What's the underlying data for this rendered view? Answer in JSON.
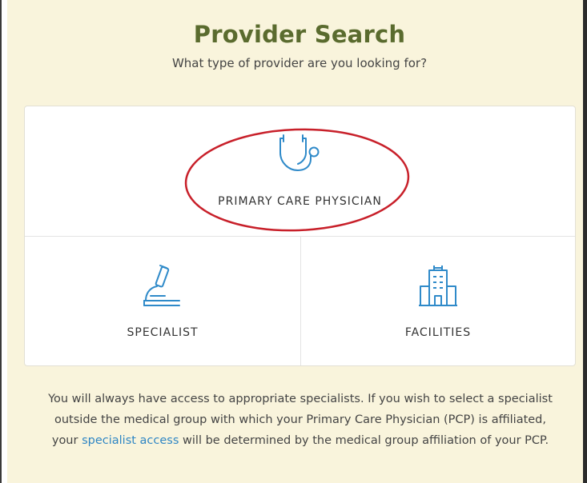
{
  "header": {
    "title": "Provider Search",
    "subtitle": "What type of provider are you looking for?"
  },
  "options": {
    "primary": {
      "label": "PRIMARY CARE PHYSICIAN",
      "icon": "stethoscope-icon"
    },
    "specialist": {
      "label": "SPECIALIST",
      "icon": "microscope-icon"
    },
    "facilities": {
      "label": "FACILITIES",
      "icon": "hospital-building-icon"
    }
  },
  "info": {
    "before_link": "You will always have access to appropriate specialists. If you wish to select a specialist outside the medical group with which your Primary Care Physician (PCP) is affiliated, your ",
    "link_text": "specialist access",
    "after_link": " will be determined by the medical group affiliation of your PCP."
  },
  "colors": {
    "title": "#5a6b2e",
    "background": "#f9f4dc",
    "icon": "#2f8ac9",
    "link": "#2f86c4",
    "annotation": "#c8202a"
  }
}
